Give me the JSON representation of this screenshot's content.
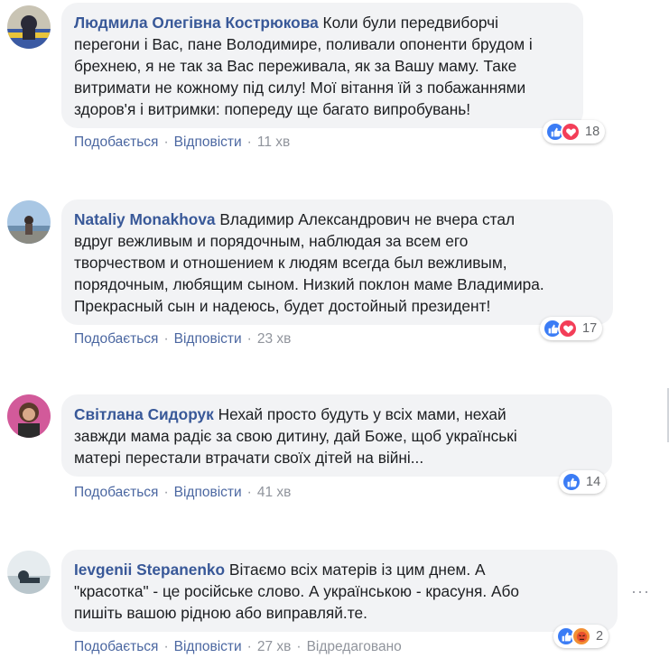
{
  "comments": [
    {
      "author": "Людмила Олегівна Кострюкова",
      "text_lines": [
        "Коли були передвиборчі",
        "перегони і Вас, пане Володимире, поливали опоненти брудом і",
        "брехнею, я не так за Вас переживала, як за Вашу маму. Таке",
        "витримати не кожному під силу! Мої вітання їй з побажаннями",
        "здоров'я і витримки: попереду ще багато випробувань!"
      ],
      "like_label": "Подобається",
      "reply_label": "Відповісти",
      "time": "11 хв",
      "reaction_icons": [
        "like-icon",
        "love-icon"
      ],
      "reaction_count": "18"
    },
    {
      "author": "Nataliy Monakhova",
      "text_lines": [
        "Владимир Александрович не вчера стал",
        "вдруг вежливым и порядочным, наблюдая за всем его",
        "творчеством и отношением к людям всегда был вежливым,",
        "порядочным, любящим сыном. Низкий поклон маме Владимира.",
        "Прекрасный сын и надеюсь, будет достойный президент!"
      ],
      "like_label": "Подобається",
      "reply_label": "Відповісти",
      "time": "23 хв",
      "reaction_icons": [
        "like-icon",
        "love-icon"
      ],
      "reaction_count": "17"
    },
    {
      "author": "Світлана Сидорук",
      "text_lines": [
        "Нехай просто будуть у всіх мами, нехай",
        "завжди мама радіє за свою дитину, дай Боже, щоб українські",
        "матері перестали втрачати своїх дітей на війні..."
      ],
      "like_label": "Подобається",
      "reply_label": "Відповісти",
      "time": "41 хв",
      "reaction_icons": [
        "like-icon"
      ],
      "reaction_count": "14"
    },
    {
      "author": "Ievgenii Stepanenko",
      "text_lines": [
        "Вітаємо всіх матерів із цим днем. А",
        "\"красотка\" - це російське слово. А українською - красуня. Або",
        "пишіть вашою рідною або виправляй.те."
      ],
      "like_label": "Подобається",
      "reply_label": "Відповісти",
      "time": "27 хв",
      "edited_label": "Відредаговано",
      "reaction_icons": [
        "like-icon",
        "angry-icon"
      ],
      "reaction_count": "2",
      "more_options": "···"
    }
  ],
  "colors": {
    "author": "#385898",
    "link": "#4b67a1",
    "meta": "#90949c",
    "bubble": "#f2f3f5",
    "like": "#3b7cf5",
    "love": "#f33e58",
    "angry": "#f28f33"
  }
}
